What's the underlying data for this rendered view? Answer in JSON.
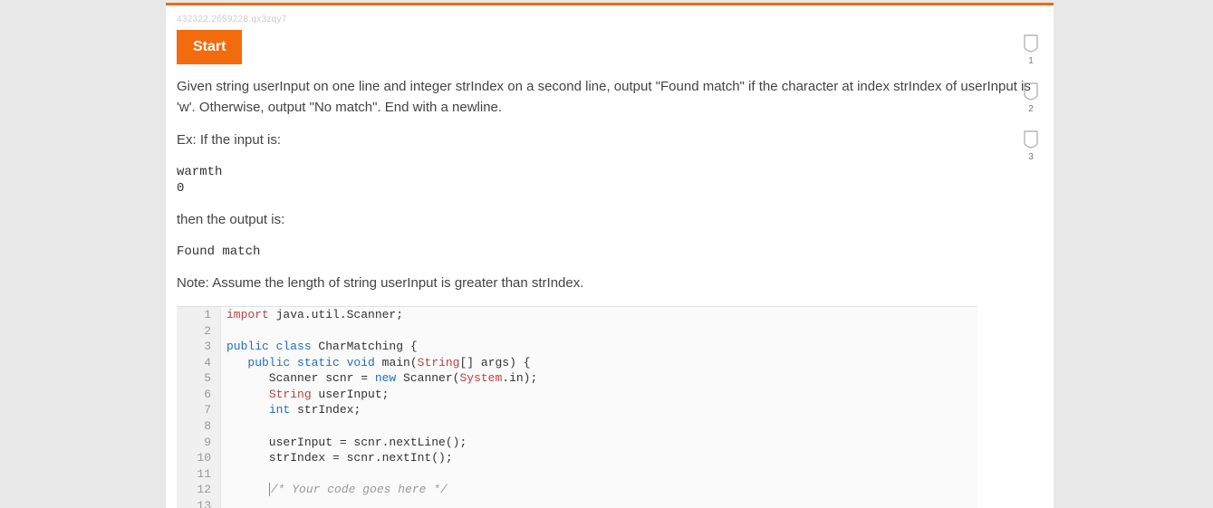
{
  "hash_id": "432322.2659228.qx3zqy7",
  "start_label": "Start",
  "problem": {
    "p1": "Given string userInput on one line and integer strIndex on a second line, output \"Found match\" if the character at index strIndex of userInput is 'w'. Otherwise, output \"No match\". End with a newline.",
    "ex_intro": "Ex: If the input is:",
    "ex_input": "warmth\n0",
    "then": "then the output is:",
    "ex_output": "Found match",
    "note": "Note: Assume the length of string userInput is greater than strIndex."
  },
  "code": {
    "lines": [
      {
        "n": "1",
        "segs": [
          {
            "t": "import ",
            "c": "kw-import"
          },
          {
            "t": "java.util.Scanner;",
            "c": ""
          }
        ]
      },
      {
        "n": "2",
        "segs": []
      },
      {
        "n": "3",
        "segs": [
          {
            "t": "public class ",
            "c": "kw-blue"
          },
          {
            "t": "CharMatching {",
            "c": ""
          }
        ]
      },
      {
        "n": "4",
        "segs": [
          {
            "t": "   ",
            "c": ""
          },
          {
            "t": "public static void ",
            "c": "kw-blue"
          },
          {
            "t": "main",
            "c": ""
          },
          {
            "t": "(",
            "c": ""
          },
          {
            "t": "String",
            "c": "kw-import"
          },
          {
            "t": "[] args) {",
            "c": ""
          }
        ]
      },
      {
        "n": "5",
        "segs": [
          {
            "t": "      Scanner scnr = ",
            "c": ""
          },
          {
            "t": "new ",
            "c": "kw-blue"
          },
          {
            "t": "Scanner(",
            "c": ""
          },
          {
            "t": "System",
            "c": "kw-import"
          },
          {
            "t": ".in);",
            "c": ""
          }
        ]
      },
      {
        "n": "6",
        "segs": [
          {
            "t": "      ",
            "c": ""
          },
          {
            "t": "String ",
            "c": "kw-import"
          },
          {
            "t": "userInput;",
            "c": ""
          }
        ]
      },
      {
        "n": "7",
        "segs": [
          {
            "t": "      ",
            "c": ""
          },
          {
            "t": "int ",
            "c": "kw-blue"
          },
          {
            "t": "strIndex;",
            "c": ""
          }
        ]
      },
      {
        "n": "8",
        "segs": []
      },
      {
        "n": "9",
        "segs": [
          {
            "t": "      userInput = scnr.nextLine();",
            "c": ""
          }
        ]
      },
      {
        "n": "10",
        "segs": [
          {
            "t": "      strIndex = scnr.nextInt();",
            "c": ""
          }
        ]
      },
      {
        "n": "11",
        "segs": []
      },
      {
        "n": "12",
        "cursor": true,
        "segs": [
          {
            "t": "      ",
            "c": ""
          },
          {
            "t": "/* Your code goes here */",
            "c": "comment"
          }
        ]
      },
      {
        "n": "13",
        "segs": []
      }
    ]
  },
  "shields": [
    {
      "num": "1"
    },
    {
      "num": "2"
    },
    {
      "num": "3"
    }
  ]
}
